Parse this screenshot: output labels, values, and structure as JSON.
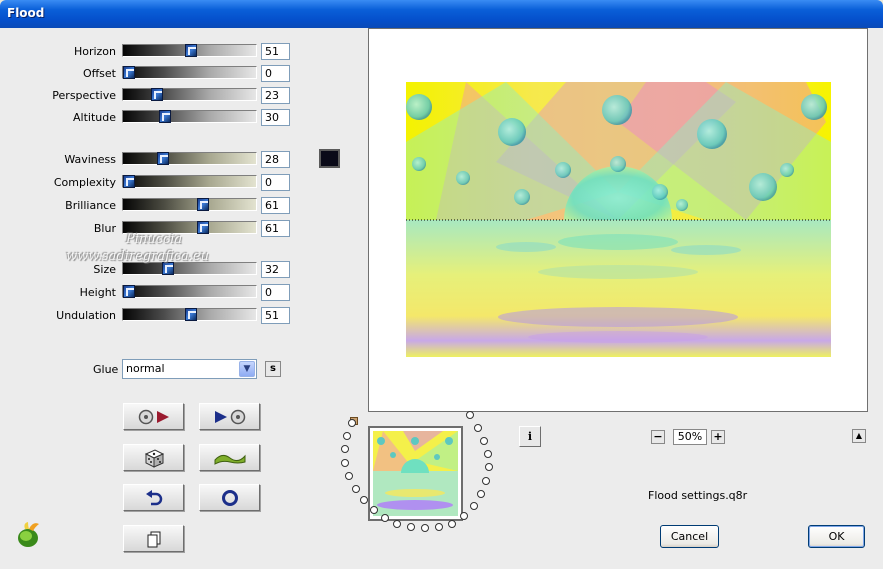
{
  "window": {
    "title": "Flood"
  },
  "sliders_group1": [
    {
      "label": "Horizon",
      "value": "51",
      "fraction": 0.51
    },
    {
      "label": "Offset",
      "value": "0",
      "fraction": 0.0
    },
    {
      "label": "Perspective",
      "value": "23",
      "fraction": 0.23
    },
    {
      "label": "Altitude",
      "value": "30",
      "fraction": 0.3
    }
  ],
  "sliders_group2": [
    {
      "label": "Waviness",
      "value": "28",
      "fraction": 0.28
    },
    {
      "label": "Complexity",
      "value": "0",
      "fraction": 0.0
    },
    {
      "label": "Brilliance",
      "value": "61",
      "fraction": 0.61
    },
    {
      "label": "Blur",
      "value": "61",
      "fraction": 0.61
    }
  ],
  "sliders_group3": [
    {
      "label": "Size",
      "value": "32",
      "fraction": 0.32
    },
    {
      "label": "Height",
      "value": "0",
      "fraction": 0.0
    },
    {
      "label": "Undulation",
      "value": "51",
      "fraction": 0.51
    }
  ],
  "color_swatch": "#0a0a18",
  "watermark": {
    "line1": "Pinuccia",
    "line2": "www.sadiregrafica.eu"
  },
  "glue": {
    "label": "Glue",
    "selected": "normal",
    "side_button": "s"
  },
  "tool_buttons": [
    "load-preset-icon",
    "save-preset-icon",
    "randomize-dice-icon",
    "wave-icon",
    "undo-icon",
    "reset-icon",
    "copy-icon"
  ],
  "zoom": {
    "value": "50%",
    "minus": "−",
    "plus": "+"
  },
  "info_button": "i",
  "settings_file": "Flood settings.q8r",
  "buttons": {
    "cancel": "Cancel",
    "ok": "OK"
  }
}
